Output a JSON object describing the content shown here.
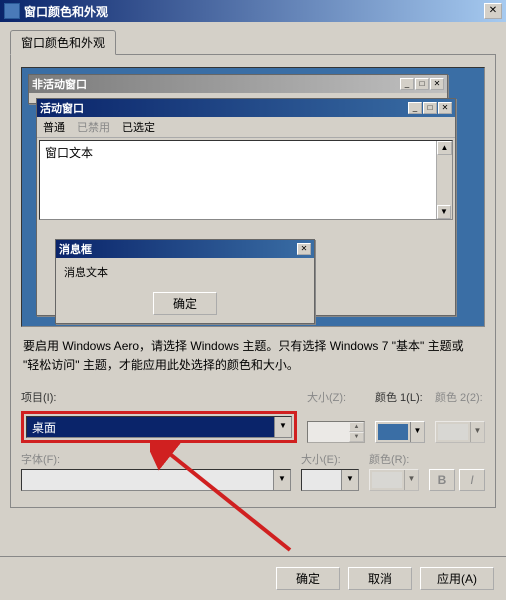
{
  "window": {
    "title": "窗口颜色和外观",
    "close": "✕"
  },
  "tab": {
    "label": "窗口颜色和外观"
  },
  "preview": {
    "inactive_title": "非活动窗口",
    "active_title": "活动窗口",
    "menu": {
      "normal": "普通",
      "disabled": "已禁用",
      "selected": "已选定"
    },
    "body_text": "窗口文本",
    "msgbox_title": "消息框",
    "msgbox_text": "消息文本",
    "msgbox_ok": "确定",
    "win_btns": {
      "min": "_",
      "max": "□",
      "close": "✕"
    },
    "scroll": {
      "up": "▲",
      "down": "▼"
    }
  },
  "description": "要启用 Windows Aero，请选择 Windows 主题。只有选择 Windows 7 \"基本\" 主题或 \"轻松访问\" 主题，才能应用此处选择的颜色和大小。",
  "form": {
    "item_label": "项目(I):",
    "item_value": "桌面",
    "size_z_label": "大小(Z):",
    "color1_label": "颜色 1(L):",
    "color1": "#3a6ea5",
    "color2_label": "颜色 2(2):",
    "font_label": "字体(F):",
    "size_e_label": "大小(E):",
    "color_r_label": "颜色(R):",
    "bold": "B",
    "italic": "I"
  },
  "buttons": {
    "ok": "确定",
    "cancel": "取消",
    "apply": "应用(A)"
  }
}
